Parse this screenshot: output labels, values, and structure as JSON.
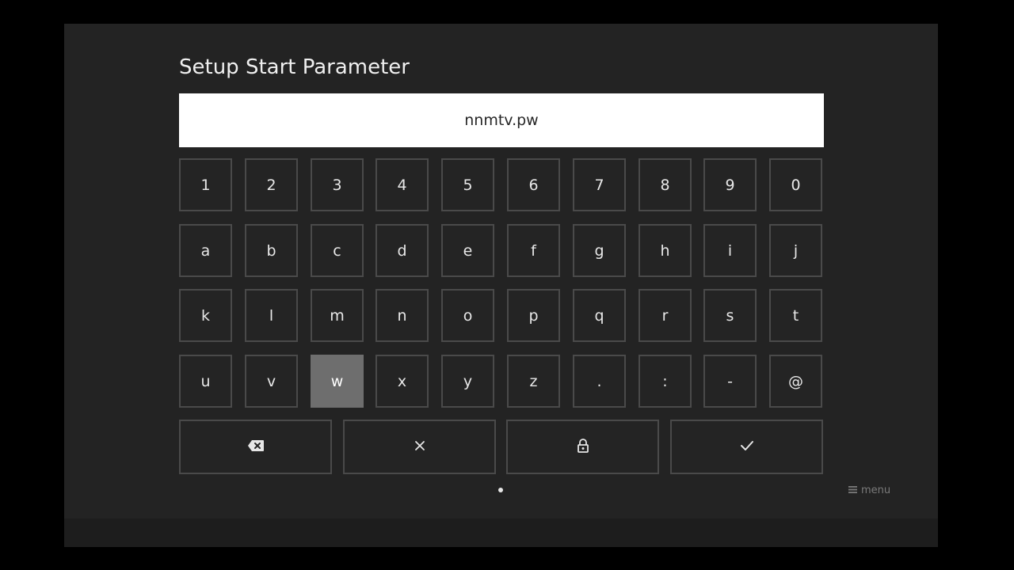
{
  "dialog": {
    "title": "Setup Start Parameter",
    "input_value": "nnmtv.pw"
  },
  "keyboard": {
    "rows": [
      [
        "1",
        "2",
        "3",
        "4",
        "5",
        "6",
        "7",
        "8",
        "9",
        "0"
      ],
      [
        "a",
        "b",
        "c",
        "d",
        "e",
        "f",
        "g",
        "h",
        "i",
        "j"
      ],
      [
        "k",
        "l",
        "m",
        "n",
        "o",
        "p",
        "q",
        "r",
        "s",
        "t"
      ],
      [
        "u",
        "v",
        "w",
        "x",
        "y",
        "z",
        ".",
        ":",
        "-",
        "@"
      ]
    ],
    "focused_key": "w",
    "action_keys": [
      {
        "name": "backspace-button",
        "icon": "backspace-icon"
      },
      {
        "name": "clear-button",
        "icon": "close-icon"
      },
      {
        "name": "lock-button",
        "icon": "lock-icon"
      },
      {
        "name": "confirm-button",
        "icon": "check-icon"
      }
    ]
  },
  "footer": {
    "menu_label": "menu",
    "menu_icon": "menu-icon"
  },
  "colors": {
    "background": "#232323",
    "key_border": "#4a4a4a",
    "focused_key": "#6e6e6e",
    "input_background": "#ffffff"
  }
}
